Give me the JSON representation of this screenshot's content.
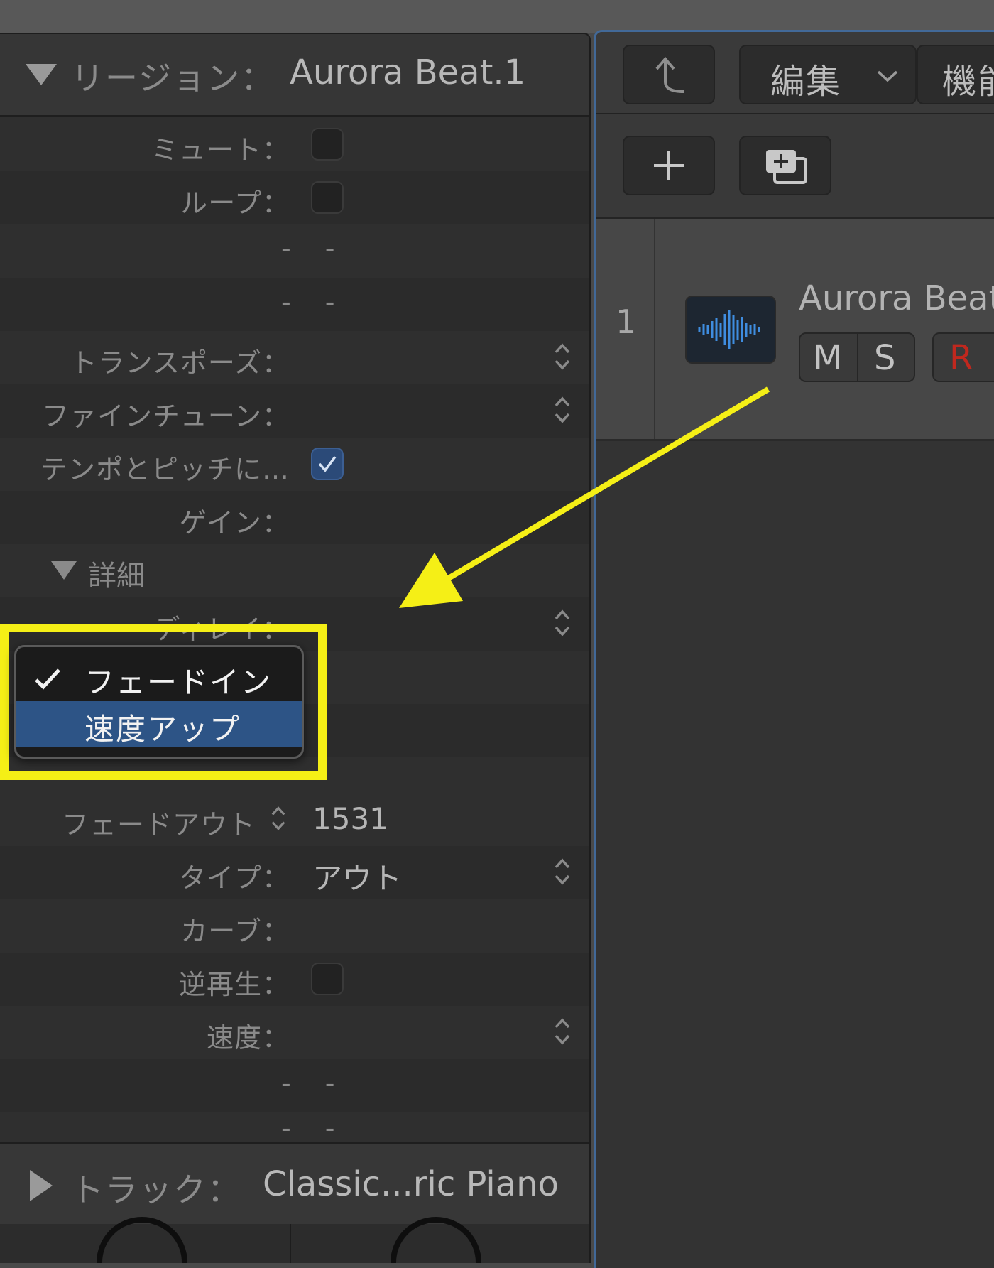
{
  "inspector": {
    "region_label": "リージョン：",
    "region_name": "Aurora Beat.1",
    "rows": {
      "mute": "ミュート：",
      "loop": "ループ：",
      "dash1": "- -",
      "dash2": "- -",
      "transpose": "トランスポーズ：",
      "finetune": "ファインチューン：",
      "tempo_pitch": "テンポとピッチに…",
      "gain": "ゲイン：",
      "detail": "詳細",
      "delay": "ディレイ：",
      "fade_out": "フェードアウト",
      "fade_out_value": "1531",
      "type": "タイプ：",
      "type_value": "アウト",
      "curve": "カーブ：",
      "reverse": "逆再生：",
      "speed": "速度：",
      "dash3": "- -",
      "dash4": "- -"
    },
    "track_label": "トラック：",
    "track_name": "Classic...ric Piano"
  },
  "popup": {
    "items": [
      {
        "label": "フェードイン",
        "checked": true
      },
      {
        "label": "速度アップ",
        "selected": true
      }
    ]
  },
  "tracks": {
    "toolbar": {
      "edit_label": "編集",
      "func_label": "機能"
    },
    "track": {
      "number": "1",
      "name": "Aurora Beat",
      "mute": "M",
      "solo": "S",
      "record": "R"
    }
  },
  "colors": {
    "highlight": "#f5ef16",
    "selection": "#2d5486",
    "accent_border": "#426998",
    "record": "#c0281e"
  },
  "icons": [
    "back-arrow-icon",
    "chevron-down-icon",
    "plus-icon",
    "duplicate-track-icon",
    "waveform-icon",
    "stepper-icon",
    "checkmark-icon"
  ]
}
